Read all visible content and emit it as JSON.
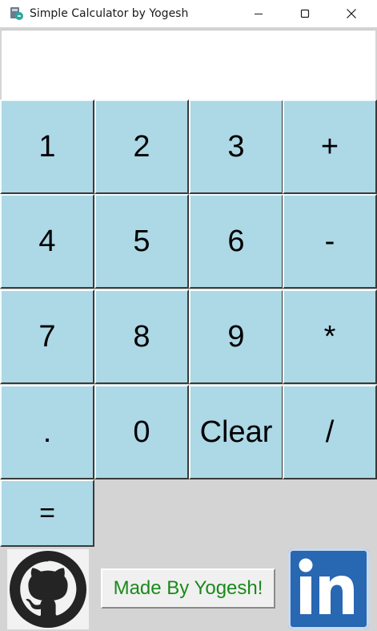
{
  "window": {
    "title": "Simple Calculator by Yogesh",
    "icon": "python-app-icon"
  },
  "display": {
    "value": ""
  },
  "keys": [
    {
      "label": "1"
    },
    {
      "label": "2"
    },
    {
      "label": "3"
    },
    {
      "label": "+"
    },
    {
      "label": "4"
    },
    {
      "label": "5"
    },
    {
      "label": "6"
    },
    {
      "label": "-"
    },
    {
      "label": "7"
    },
    {
      "label": "8"
    },
    {
      "label": "9"
    },
    {
      "label": "*"
    },
    {
      "label": "."
    },
    {
      "label": "0"
    },
    {
      "label": "Clear"
    },
    {
      "label": "/"
    },
    {
      "label": "="
    }
  ],
  "footer": {
    "made_by": "Made By Yogesh!",
    "github_icon": "github-icon",
    "linkedin_icon": "linkedin-icon"
  },
  "colors": {
    "key_bg": "#add8e6",
    "made_by_text": "#1a8a1a",
    "linkedin_blue": "#2867b2"
  }
}
